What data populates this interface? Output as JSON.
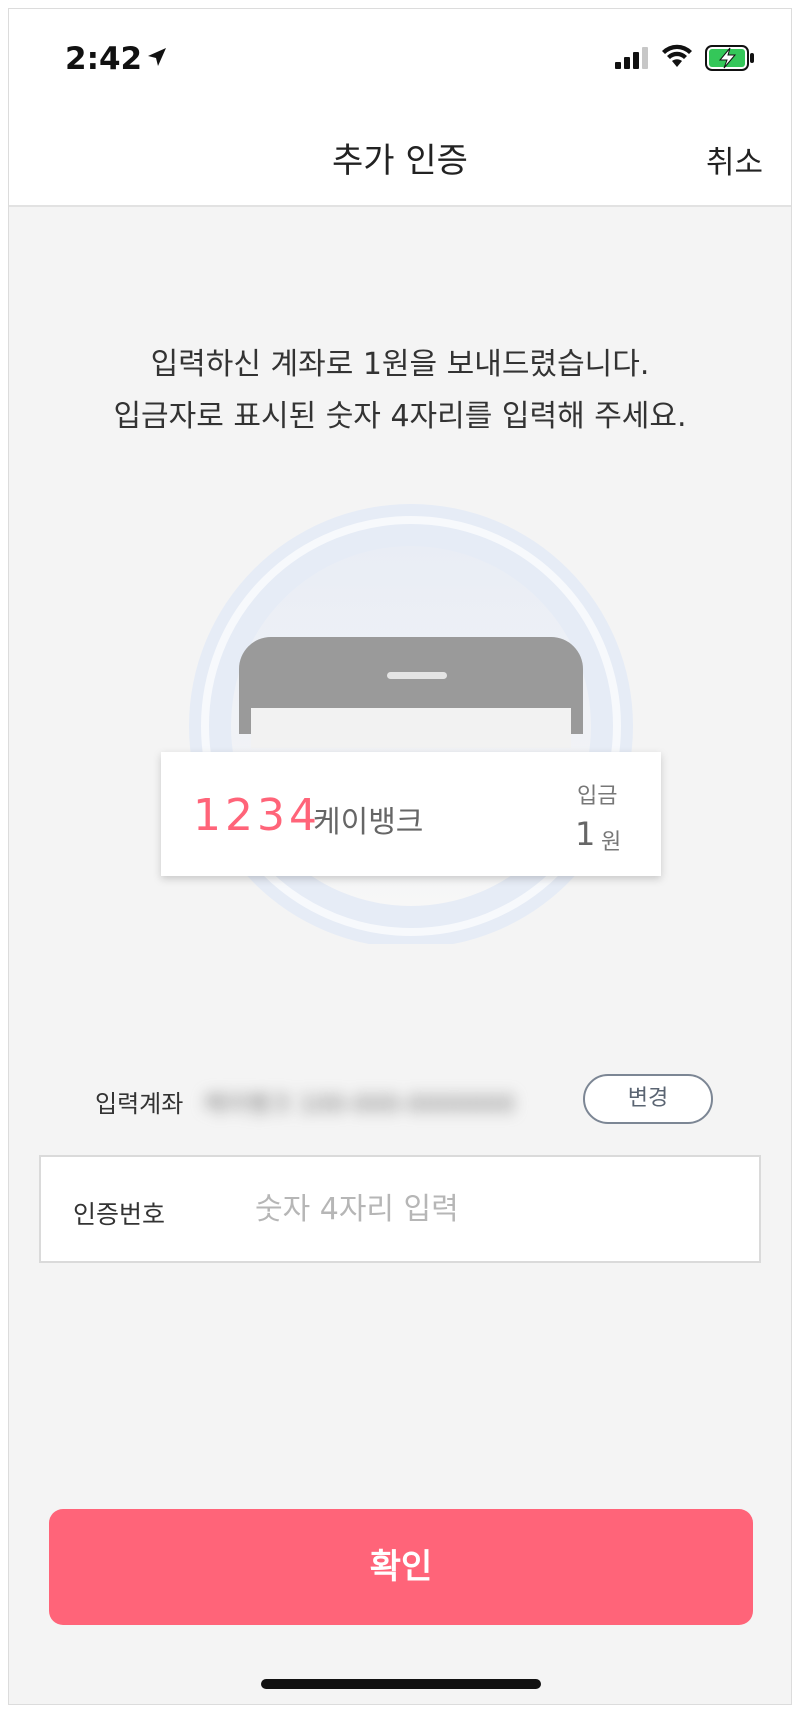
{
  "status_bar": {
    "time": "2:42",
    "icons": [
      "location-arrow-icon",
      "cellular-signal-icon",
      "wifi-icon",
      "battery-charging-icon"
    ],
    "battery_color": "#34c759"
  },
  "header": {
    "title": "추가 인증",
    "cancel_label": "취소"
  },
  "instruction": {
    "line1": "입력하신 계좌로 1원을 보내드렸습니다.",
    "line2": "입금자로 표시된 숫자 4자리를 입력해 주세요."
  },
  "illustration": {
    "code": "1234",
    "sender": "케이뱅크",
    "deposit_label": "입금",
    "amount": "1",
    "currency": "원",
    "code_color": "#ff6479"
  },
  "account": {
    "label": "입력계좌",
    "value": "케이뱅크 100-000-0000000",
    "change_label": "변경"
  },
  "verification": {
    "label": "인증번호",
    "placeholder": "숫자 4자리 입력",
    "value": ""
  },
  "confirm_label": "확인",
  "colors": {
    "accent": "#ff6479",
    "background": "#f4f4f4"
  }
}
